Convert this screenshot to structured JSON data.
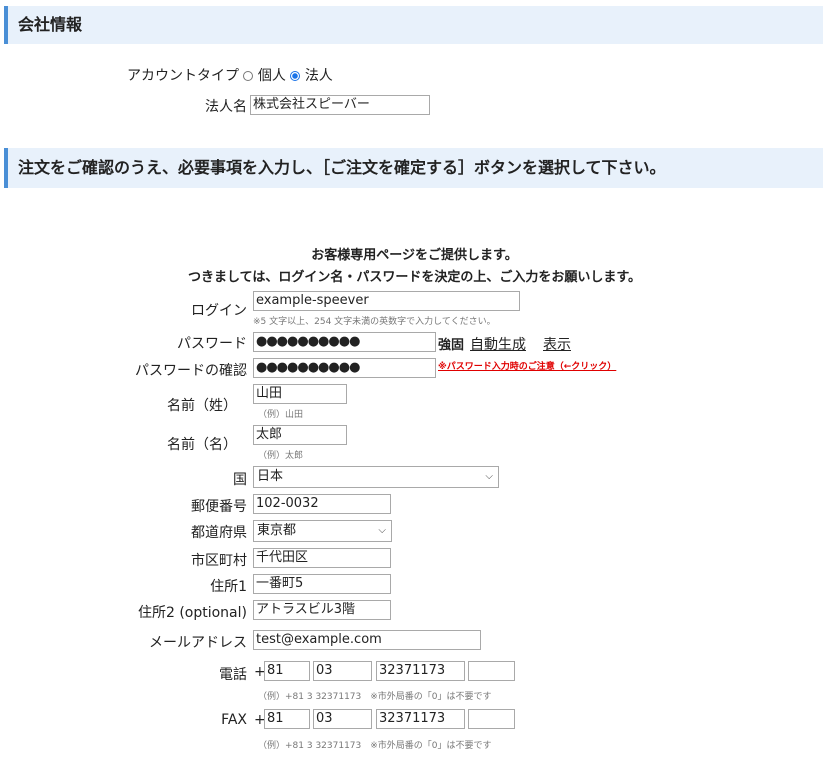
{
  "company_section": {
    "title": "会社情報",
    "account_type_label": "アカウントタイプ",
    "options": [
      {
        "label": "個人",
        "selected": false
      },
      {
        "label": "法人",
        "selected": true
      }
    ],
    "company_name_label": "法人名",
    "company_name_value": "株式会社スピーバー"
  },
  "order_section": {
    "title": "注文をご確認のうえ、必要事項を入力し、［ご注文を確定する］ボタンを選択して下さい。",
    "intro_line1": "お客様専用ページをご提供します。",
    "intro_line2": "つきましては、ログイン名・パスワードを決定の上、ご入力をお願いします。"
  },
  "form": {
    "login_label": "ログイン",
    "login_value": "example-speever",
    "login_hint": "※5 文字以上、254 文字未満の英数字で入力してください。",
    "password_label": "パスワード",
    "password_value": "●●●●●●●●●●",
    "password_strength": "強固",
    "auto_generate": "自動生成",
    "show": "表示",
    "password_confirm_label": "パスワードの確認",
    "password_confirm_value": "●●●●●●●●●●",
    "password_warning": "※パスワード入力時のご注意（←クリック）",
    "last_name_label": "名前（姓）",
    "last_name_value": "山田",
    "last_name_hint": "（例）山田",
    "first_name_label": "名前（名）",
    "first_name_value": "太郎",
    "first_name_hint": "（例）太郎",
    "country_label": "国",
    "country_value": "日本",
    "postal_label": "郵便番号",
    "postal_value": "102-0032",
    "prefecture_label": "都道府県",
    "prefecture_value": "東京都",
    "city_label": "市区町村",
    "city_value": "千代田区",
    "address1_label": "住所1",
    "address1_value": "一番町5",
    "address2_label": "住所2 (optional)",
    "address2_value": "アトラスビル3階",
    "email_label": "メールアドレス",
    "email_value": "test@example.com",
    "phone_label": "電話",
    "plus": "+",
    "phone_country": "81",
    "phone_area": "03",
    "phone_number": "32371173",
    "phone_ext": "",
    "phone_hint": "（例）+81 3 32371173　※市外局番の「0」は不要です",
    "fax_label": "FAX",
    "fax_country": "81",
    "fax_area": "03",
    "fax_number": "32371173",
    "fax_ext": "",
    "fax_hint": "（例）+81 3 32371173　※市外局番の「0」は不要です"
  },
  "colors": {
    "section_bg": "#e8f1fb",
    "section_accent": "#4a8fd6",
    "radio_selected": "#1a73e8",
    "warning": "#e00000"
  }
}
